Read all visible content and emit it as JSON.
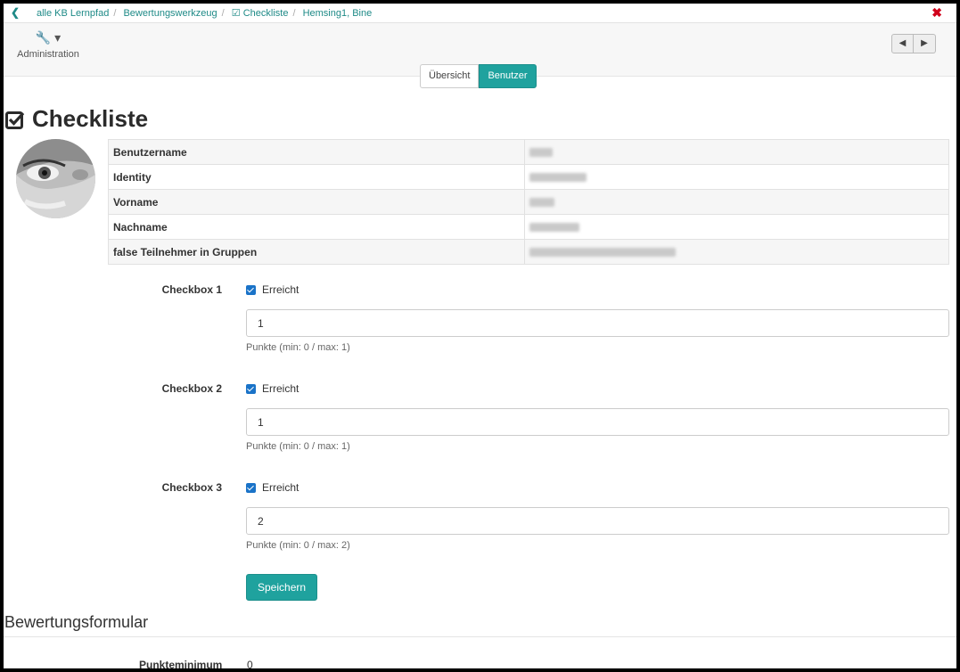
{
  "breadcrumb": {
    "items": [
      "alle KB Lernpfad",
      "Bewertungswerkzeug",
      "Checkliste",
      "Hemsing1, Bine"
    ]
  },
  "toolbar": {
    "admin_label": "Administration"
  },
  "tabs": {
    "overview": "Übersicht",
    "users": "Benutzer"
  },
  "page_title": "Checkliste",
  "user_info": [
    {
      "key": "Benutzername"
    },
    {
      "key": "Identity"
    },
    {
      "key": "Vorname"
    },
    {
      "key": "Nachname"
    },
    {
      "key": "false Teilnehmer in Gruppen"
    }
  ],
  "checkboxes": [
    {
      "label": "Checkbox 1",
      "check_label": "Erreicht",
      "checked": true,
      "value": "1",
      "help": "Punkte (min: 0 / max: 1)"
    },
    {
      "label": "Checkbox 2",
      "check_label": "Erreicht",
      "checked": true,
      "value": "1",
      "help": "Punkte (min: 0 / max: 1)"
    },
    {
      "label": "Checkbox 3",
      "check_label": "Erreicht",
      "checked": true,
      "value": "2",
      "help": "Punkte (min: 0 / max: 2)"
    }
  ],
  "save_label": "Speichern",
  "assessment": {
    "title": "Bewertungsformular",
    "min_label": "Punkteminimum",
    "min_value": "0"
  },
  "colors": {
    "accent": "#1fa29e",
    "link": "#1e8a87",
    "close": "#d0021b"
  }
}
